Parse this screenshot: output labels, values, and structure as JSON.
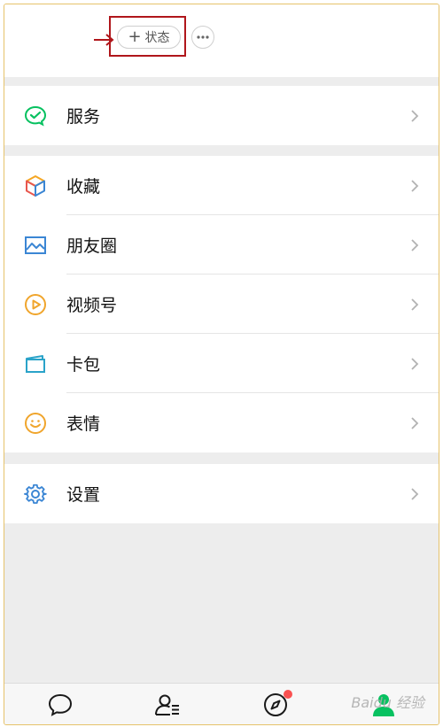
{
  "header": {
    "status_button_label": "状态",
    "status_button_prefix": "+",
    "more_button_icon": "ellipsis-icon"
  },
  "menu_groups": [
    {
      "items": [
        {
          "label": "服务",
          "icon": "wechat-pay-icon"
        }
      ]
    },
    {
      "items": [
        {
          "label": "收藏",
          "icon": "cube-icon"
        },
        {
          "label": "朋友圈",
          "icon": "image-landscape-icon"
        },
        {
          "label": "视频号",
          "icon": "play-circle-icon"
        },
        {
          "label": "卡包",
          "icon": "wallet-card-icon"
        },
        {
          "label": "表情",
          "icon": "smiley-icon"
        }
      ]
    },
    {
      "items": [
        {
          "label": "设置",
          "icon": "gear-icon"
        }
      ]
    }
  ],
  "tabbar": {
    "tabs": [
      {
        "name": "chats",
        "icon": "chat-bubble-icon",
        "active": false
      },
      {
        "name": "contacts",
        "icon": "contacts-icon",
        "active": false
      },
      {
        "name": "discover",
        "icon": "compass-icon",
        "active": false,
        "badge": true
      },
      {
        "name": "me",
        "icon": "person-icon",
        "active": true
      }
    ]
  },
  "watermark": "Baidu 经验",
  "colors": {
    "active_green": "#07c160",
    "highlight_red": "#b0161b",
    "badge_red": "#fa5151",
    "frame_border": "#e6c26a"
  }
}
